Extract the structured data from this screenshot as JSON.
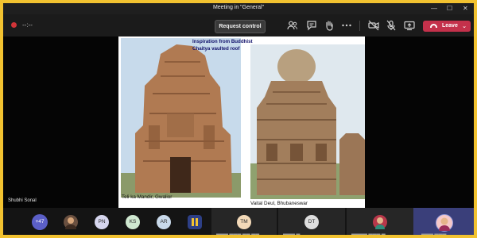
{
  "window": {
    "title": "Meeting in \"General\"",
    "controls": [
      "—",
      "☐",
      "✕"
    ]
  },
  "toolbar": {
    "timer": "--:--",
    "request_control": "Request control",
    "leave": "Leave",
    "icons": [
      "people-icon",
      "chat-icon",
      "raise-hand-icon",
      "more-icon",
      "camera-off-icon",
      "mic-off-icon",
      "share-icon",
      "phone-icon"
    ]
  },
  "stage": {
    "presenter": "Shubhi Sonal",
    "slide": {
      "note": "Inspiration from Buddhist Chaitya  vaulted roof",
      "caption_left": "Teli ka Mandir, Gwalior",
      "caption_right": "Vaital Deul, Bhubaneswar"
    }
  },
  "participants": {
    "overflow": "+47",
    "avatars": [
      {
        "initials": "PN",
        "color": "#d6d6ee"
      },
      {
        "initials": "KS",
        "color": "#cfe8d0"
      },
      {
        "initials": "AR",
        "color": "#c9d9ea"
      },
      {
        "initials": "TM",
        "color": "#f3d9b8"
      },
      {
        "initials": "DT",
        "color": "#dedede"
      }
    ],
    "colors": {
      "overflow": "#5b5fc7",
      "active_tile": "#3a3f7a",
      "leave": "#c4314b",
      "frame": "#f2c230"
    }
  }
}
